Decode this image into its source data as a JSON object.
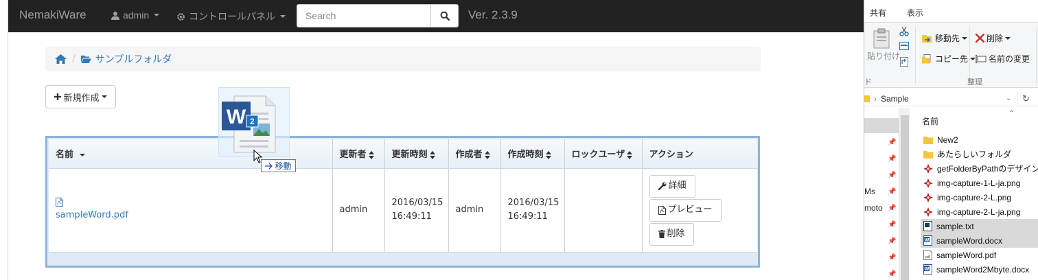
{
  "navbar": {
    "brand": "NemakiWare",
    "user_menu": "admin",
    "control_panel": "コントロールパネル",
    "search_placeholder": "Search",
    "version": "Ver. 2.3.9"
  },
  "breadcrumb": {
    "separator": "/",
    "folder": "サンプルフォルダ"
  },
  "new_button": "新規作成",
  "drag": {
    "badge": "2",
    "label": "移動"
  },
  "table": {
    "headers": [
      "名前",
      "更新者",
      "更新時刻",
      "作成者",
      "作成時刻",
      "ロックユーザ",
      "アクション"
    ],
    "row": {
      "name": "sampleWord.pdf",
      "modifier": "admin",
      "modified": "2016/03/15 16:49:11",
      "creator": "admin",
      "created": "2016/03/15 16:49:11",
      "lock_user": ""
    },
    "actions": [
      "詳細",
      "プレビュー",
      "削除"
    ]
  },
  "explorer": {
    "tabs": [
      "共有",
      "表示"
    ],
    "ribbon": {
      "paste": "貼り付け",
      "move_to": "移動先",
      "copy_to": "コピー先",
      "delete": "削除",
      "rename": "名前の変更",
      "group_organize": "整理",
      "group_clipboard_partial": "ド"
    },
    "path": "Sample",
    "nav_partial": [
      "Ms",
      "moto"
    ],
    "column_name": "名前",
    "files": [
      {
        "name": "New2",
        "type": "folder"
      },
      {
        "name": "あたらしいフォルダ",
        "type": "folder"
      },
      {
        "name": "getFolderByPathのデザインビュ",
        "type": "image"
      },
      {
        "name": "img-capture-1-L-ja.png",
        "type": "image"
      },
      {
        "name": "img-capture-2-L.png",
        "type": "image"
      },
      {
        "name": "img-capture-2-L-ja.png",
        "type": "image"
      },
      {
        "name": "sample.txt",
        "type": "text"
      },
      {
        "name": "sampleWord.docx",
        "type": "word"
      },
      {
        "name": "sampleWord.pdf",
        "type": "pdf"
      },
      {
        "name": "sampleWord2Mbyte.docx",
        "type": "word"
      }
    ]
  },
  "colors": {
    "navbar": "#222222",
    "link": "#337ab7",
    "table_border": "#8db4d8"
  }
}
